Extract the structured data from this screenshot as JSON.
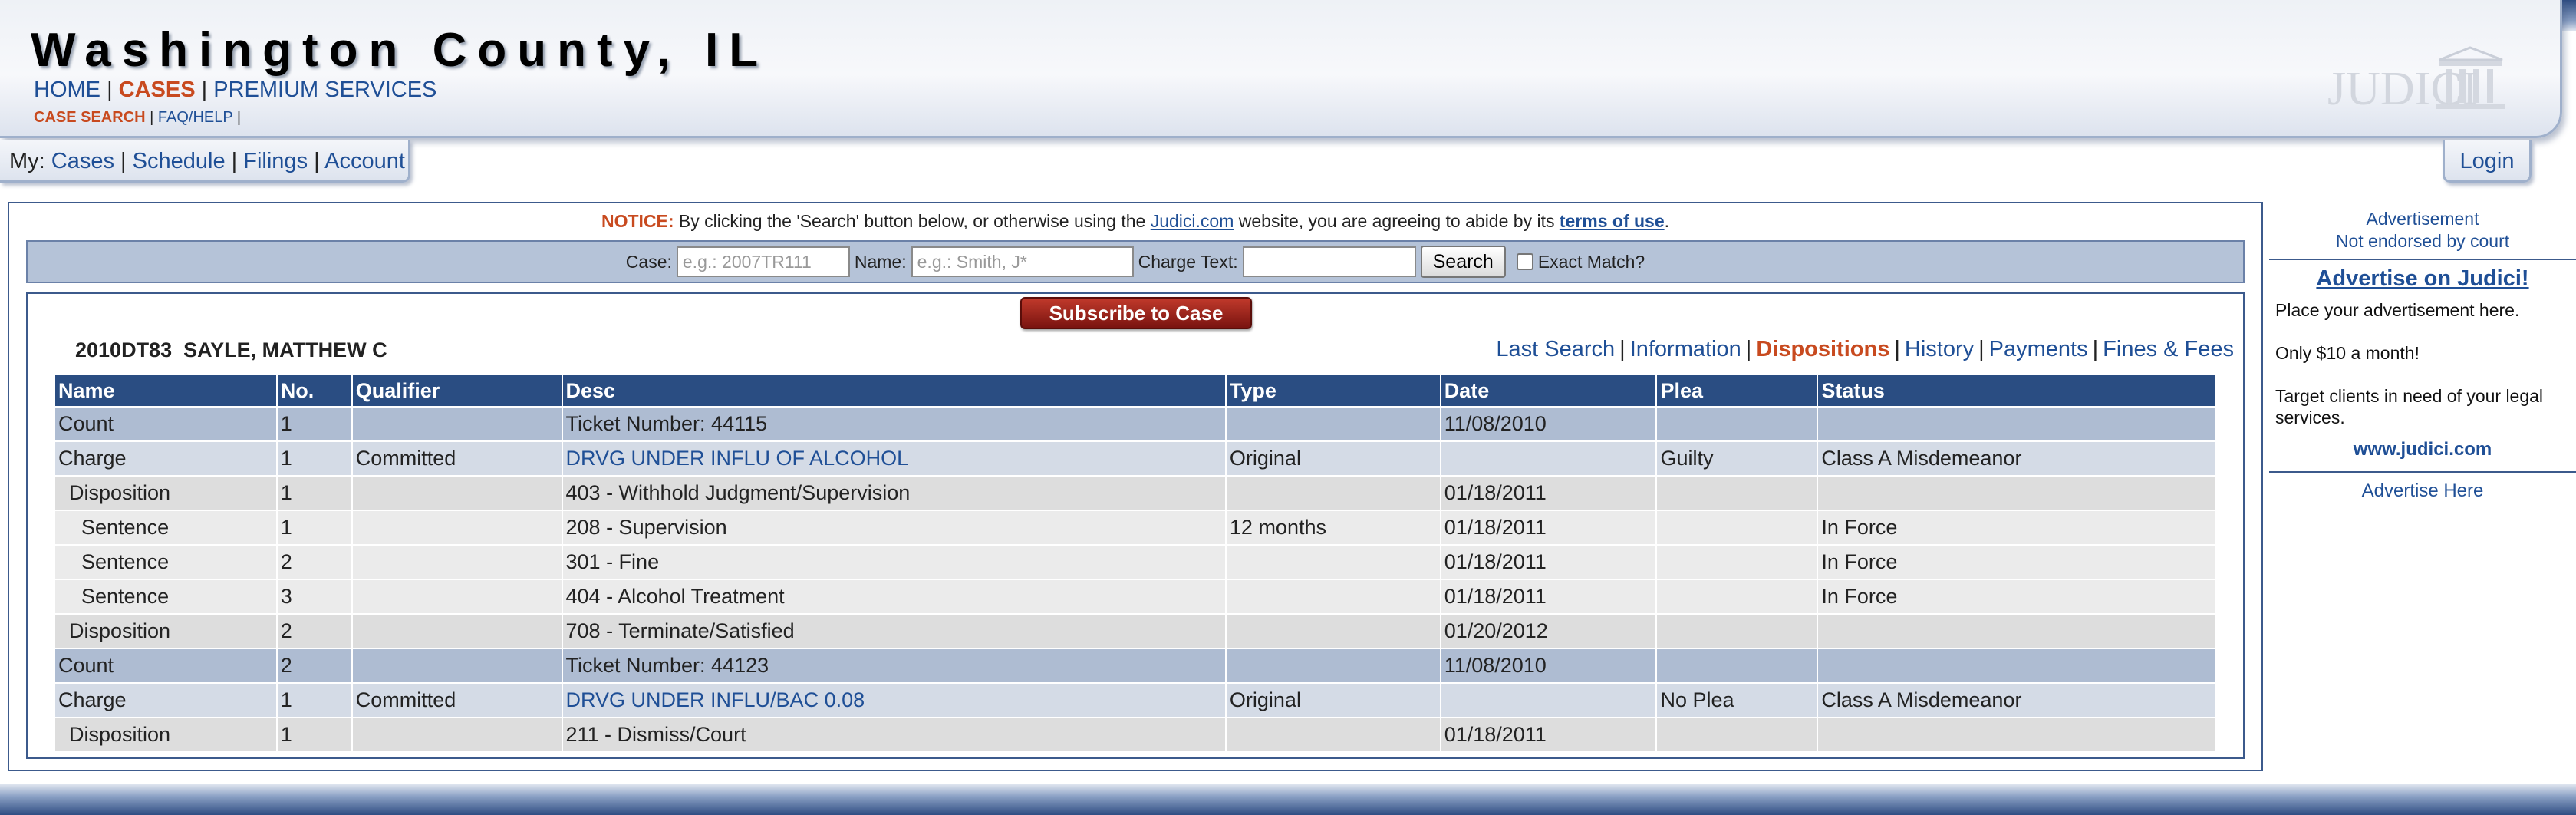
{
  "header": {
    "title": "Washington County, IL",
    "nav": [
      {
        "label": "HOME"
      },
      {
        "label": "CASES"
      },
      {
        "label": "PREMIUM SERVICES"
      }
    ],
    "subnav": [
      {
        "label": "CASE SEARCH"
      },
      {
        "label": "FAQ/HELP"
      }
    ],
    "logo_text": "JUDICI"
  },
  "mybar": {
    "prefix": "My:",
    "links": [
      "Cases",
      "Schedule",
      "Filings",
      "Account"
    ]
  },
  "login_label": "Login",
  "notice": {
    "label": "NOTICE:",
    "text_before": " By clicking the 'Search' button below, or otherwise using the ",
    "link": "Judici.com",
    "text_after": " website, you are agreeing to abide by its ",
    "terms": "terms of use",
    "end": "."
  },
  "search": {
    "case_label": "Case:",
    "case_placeholder": "e.g.: 2007TR111",
    "name_label": "Name:",
    "name_placeholder": "e.g.: Smith, J*",
    "charge_label": "Charge Text:",
    "button": "Search",
    "exact_label": "Exact Match?"
  },
  "case": {
    "subscribe_label": "Subscribe to Case",
    "id": "2010DT83",
    "party": "SAYLE, MATTHEW C",
    "tabs": [
      "Last Search",
      "Information",
      "Dispositions",
      "History",
      "Payments",
      "Fines & Fees"
    ]
  },
  "table": {
    "headers": [
      "Name",
      "No.",
      "Qualifier",
      "Desc",
      "Type",
      "Date",
      "Plea",
      "Status"
    ],
    "rows": [
      {
        "name": "Count",
        "no": "1",
        "qualifier": "",
        "desc": "Ticket Number: 44115",
        "type": "",
        "date": "11/08/2010",
        "plea": "",
        "status": ""
      },
      {
        "name": "Charge",
        "no": "1",
        "qualifier": "Committed",
        "desc": "DRVG UNDER INFLU OF ALCOHOL",
        "type": "Original",
        "date": "",
        "plea": "Guilty",
        "status": "Class A Misdemeanor"
      },
      {
        "name": "Disposition",
        "no": "1",
        "qualifier": "",
        "desc": "403 - Withhold Judgment/Supervision",
        "type": "",
        "date": "01/18/2011",
        "plea": "",
        "status": ""
      },
      {
        "name": "Sentence",
        "no": "1",
        "qualifier": "",
        "desc": "208 - Supervision",
        "type": "12 months",
        "date": "01/18/2011",
        "plea": "",
        "status": "In Force"
      },
      {
        "name": "Sentence",
        "no": "2",
        "qualifier": "",
        "desc": "301 - Fine",
        "type": "",
        "date": "01/18/2011",
        "plea": "",
        "status": "In Force"
      },
      {
        "name": "Sentence",
        "no": "3",
        "qualifier": "",
        "desc": "404 - Alcohol Treatment",
        "type": "",
        "date": "01/18/2011",
        "plea": "",
        "status": "In Force"
      },
      {
        "name": "Disposition",
        "no": "2",
        "qualifier": "",
        "desc": "708 - Terminate/Satisfied",
        "type": "",
        "date": "01/20/2012",
        "plea": "",
        "status": ""
      },
      {
        "name": "Count",
        "no": "2",
        "qualifier": "",
        "desc": "Ticket Number: 44123",
        "type": "",
        "date": "11/08/2010",
        "plea": "",
        "status": ""
      },
      {
        "name": "Charge",
        "no": "1",
        "qualifier": "Committed",
        "desc": "DRVG UNDER INFLU/BAC 0.08",
        "type": "Original",
        "date": "",
        "plea": "No Plea",
        "status": "Class A Misdemeanor"
      },
      {
        "name": "Disposition",
        "no": "1",
        "qualifier": "",
        "desc": "211 - Dismiss/Court",
        "type": "",
        "date": "01/18/2011",
        "plea": "",
        "status": ""
      }
    ]
  },
  "ad": {
    "line1": "Advertisement",
    "line2": "Not endorsed by court",
    "title": "Advertise on Judici!",
    "p1": "Place your advertisement here.",
    "p2": "Only $10 a month!",
    "p3": "Target clients in need of your legal services.",
    "site": "www.judici.com",
    "here": "Advertise Here"
  },
  "colors": {
    "brand_blue": "#2a4d82",
    "accent_orange": "#c84a1f",
    "link_blue": "#1f4f96",
    "subscribe_red": "#9b2318"
  }
}
